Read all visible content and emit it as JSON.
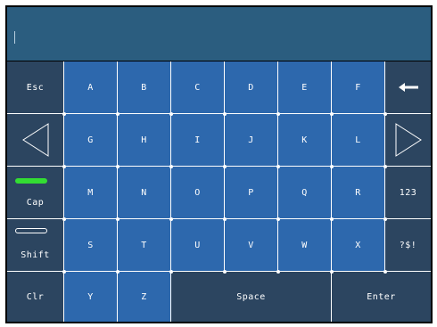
{
  "input": {
    "value": ""
  },
  "keys": {
    "esc": "Esc",
    "row1": [
      "A",
      "B",
      "C",
      "D",
      "E",
      "F"
    ],
    "row2": [
      "G",
      "H",
      "I",
      "J",
      "K",
      "L"
    ],
    "row3": [
      "M",
      "N",
      "O",
      "P",
      "Q",
      "R"
    ],
    "row4": [
      "S",
      "T",
      "U",
      "V",
      "W",
      "X"
    ],
    "cap": "Cap",
    "shift": "Shift",
    "clr": "Clr",
    "y": "Y",
    "z": "Z",
    "space": "Space",
    "enter": "Enter",
    "numbers": "123",
    "symbols": "?$!",
    "backspace_icon": "arrow-left-icon",
    "cursor_left_icon": "triangle-left-icon",
    "cursor_right_icon": "triangle-right-icon"
  },
  "indicators": {
    "cap_active": true,
    "shift_active": false
  },
  "colors": {
    "key": "#2d68ad",
    "function_key": "#2c4560",
    "display": "#2b5d7f",
    "cap_indicator_on": "#33dd33"
  }
}
